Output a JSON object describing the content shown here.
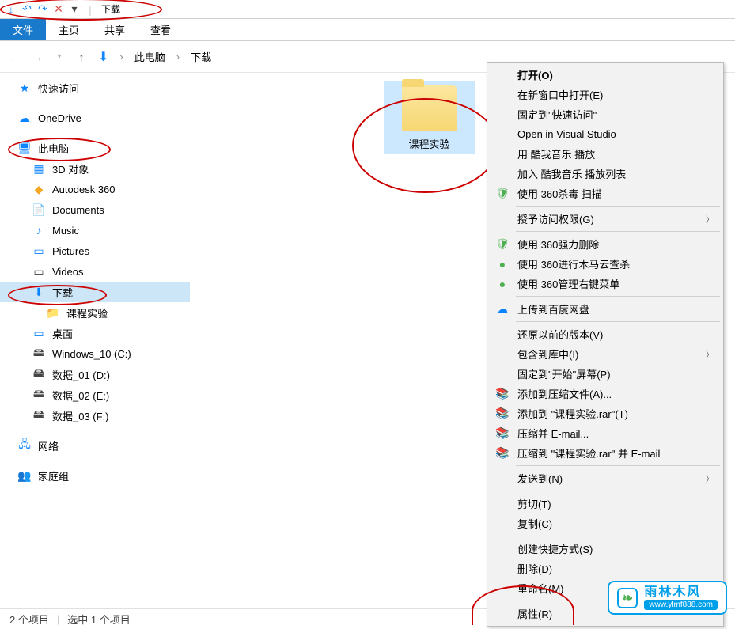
{
  "title": "下载",
  "menu": {
    "file": "文件",
    "home": "主页",
    "share": "共享",
    "view": "查看"
  },
  "breadcrumb": {
    "pc": "此电脑",
    "downloads": "下载"
  },
  "sidebar": {
    "quick": "快速访问",
    "onedrive": "OneDrive",
    "thispc": "此电脑",
    "objects3d": "3D 对象",
    "autodesk": "Autodesk 360",
    "documents": "Documents",
    "music": "Music",
    "pictures": "Pictures",
    "videos": "Videos",
    "downloads": "下载",
    "course_exp": "课程实验",
    "desktop": "桌面",
    "win10": "Windows_10 (C:)",
    "data01": "数据_01 (D:)",
    "data02": "数据_02 (E:)",
    "data03": "数据_03 (F:)",
    "network": "网络",
    "homegroup": "家庭组"
  },
  "main": {
    "folder_label": "课程实验"
  },
  "context": {
    "open": "打开(O)",
    "open_new_window": "在新窗口中打开(E)",
    "pin_quick": "固定到\"快速访问\"",
    "open_vs": "Open in Visual Studio",
    "play_kuwo": "用 酷我音乐 播放",
    "add_kuwo": "加入 酷我音乐 播放列表",
    "scan_360": "使用 360杀毒 扫描",
    "grant_access": "授予访问权限(G)",
    "force_delete_360": "使用 360强力删除",
    "trojan_360": "使用 360进行木马云查杀",
    "manage_360": "使用 360管理右键菜单",
    "baidu_upload": "上传到百度网盘",
    "restore_versions": "还原以前的版本(V)",
    "include_library": "包含到库中(I)",
    "pin_start": "固定到\"开始\"屏幕(P)",
    "add_archive": "添加到压缩文件(A)...",
    "add_rar": "添加到 \"课程实验.rar\"(T)",
    "compress_email": "压缩并 E-mail...",
    "compress_rar_email": "压缩到 \"课程实验.rar\" 并 E-mail",
    "send_to": "发送到(N)",
    "cut": "剪切(T)",
    "copy": "复制(C)",
    "create_shortcut": "创建快捷方式(S)",
    "delete": "删除(D)",
    "rename": "重命名(M)",
    "properties": "属性(R)"
  },
  "status": {
    "count": "2 个项目",
    "selected": "选中 1 个项目"
  },
  "watermark": {
    "title": "雨林木风",
    "url": "www.ylmf888.com"
  }
}
